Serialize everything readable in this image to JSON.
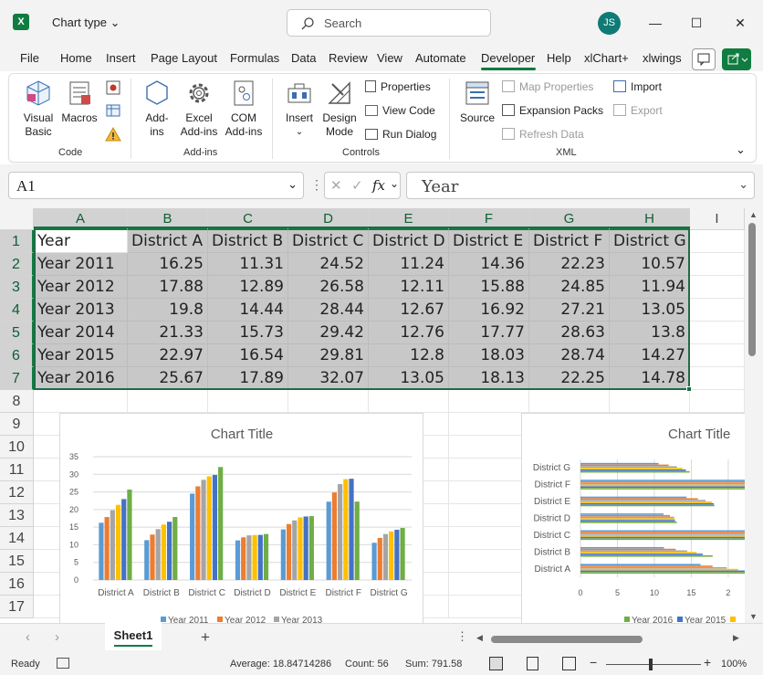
{
  "window": {
    "title": "Chart type",
    "user_initials": "JS"
  },
  "search": {
    "placeholder": "Search"
  },
  "tabs": [
    "File",
    "Home",
    "Insert",
    "Page Layout",
    "Formulas",
    "Data",
    "Review",
    "View",
    "Automate",
    "Developer",
    "Help",
    "xlChart+",
    "xlwings"
  ],
  "active_tab": "Developer",
  "ribbon": {
    "code": {
      "label": "Code",
      "visual_basic": [
        "Visual",
        "Basic"
      ],
      "macros": "Macros"
    },
    "addins": {
      "label": "Add-ins",
      "addins": [
        "Add-",
        "ins"
      ],
      "excel_addins": [
        "Excel",
        "Add-ins"
      ],
      "com_addins": [
        "COM",
        "Add-ins"
      ]
    },
    "controls": {
      "label": "Controls",
      "insert": "Insert",
      "design_mode": [
        "Design",
        "Mode"
      ],
      "properties": "Properties",
      "view_code": "View Code",
      "run_dialog": "Run Dialog"
    },
    "xml": {
      "label": "XML",
      "source": "Source",
      "map_properties": "Map Properties",
      "expansion_packs": "Expansion Packs",
      "refresh_data": "Refresh Data",
      "import": "Import",
      "export": "Export"
    }
  },
  "formula_bar": {
    "name_box": "A1",
    "formula": "Year"
  },
  "sheet": {
    "columns": [
      "A",
      "B",
      "C",
      "D",
      "E",
      "F",
      "G",
      "H",
      "I"
    ],
    "rows": [
      "1",
      "2",
      "3",
      "4",
      "5",
      "6",
      "7",
      "8",
      "9",
      "10",
      "11",
      "12",
      "13",
      "14",
      "15",
      "16",
      "17"
    ],
    "header_row": [
      "Year",
      "District A",
      "District B",
      "District C",
      "District D",
      "District E",
      "District F",
      "District G"
    ],
    "data": [
      [
        "Year 2011",
        "16.25",
        "11.31",
        "24.52",
        "11.24",
        "14.36",
        "22.23",
        "10.57"
      ],
      [
        "Year 2012",
        "17.88",
        "12.89",
        "26.58",
        "12.11",
        "15.88",
        "24.85",
        "11.94"
      ],
      [
        "Year 2013",
        "19.8",
        "14.44",
        "28.44",
        "12.67",
        "16.92",
        "27.21",
        "13.05"
      ],
      [
        "Year 2014",
        "21.33",
        "15.73",
        "29.42",
        "12.76",
        "17.77",
        "28.63",
        "13.8"
      ],
      [
        "Year 2015",
        "22.97",
        "16.54",
        "29.81",
        "12.8",
        "18.03",
        "28.74",
        "14.27"
      ],
      [
        "Year 2016",
        "25.67",
        "17.89",
        "32.07",
        "13.05",
        "18.13",
        "22.25",
        "14.78"
      ]
    ]
  },
  "chart_data": [
    {
      "type": "bar",
      "title": "Chart Title",
      "categories": [
        "District A",
        "District B",
        "District C",
        "District D",
        "District E",
        "District F",
        "District G"
      ],
      "ylim": [
        0,
        35
      ],
      "yticks": [
        "0",
        "5",
        "10",
        "15",
        "20",
        "25",
        "30",
        "35"
      ],
      "grid": true,
      "legend_position": "bottom",
      "legend_visible": [
        "Year 2011",
        "Year 2012",
        "Year 2013"
      ],
      "series": [
        {
          "name": "Year 2011",
          "values": [
            16.25,
            11.31,
            24.52,
            11.24,
            14.36,
            22.23,
            10.57
          ],
          "color": "#5b9bd5"
        },
        {
          "name": "Year 2012",
          "values": [
            17.88,
            12.89,
            26.58,
            12.11,
            15.88,
            24.85,
            11.94
          ],
          "color": "#ed7d31"
        },
        {
          "name": "Year 2013",
          "values": [
            19.8,
            14.44,
            28.44,
            12.67,
            16.92,
            27.21,
            13.05
          ],
          "color": "#a5a5a5"
        },
        {
          "name": "Year 2014",
          "values": [
            21.33,
            15.73,
            29.42,
            12.76,
            17.77,
            28.63,
            13.8
          ],
          "color": "#ffc000"
        },
        {
          "name": "Year 2015",
          "values": [
            22.97,
            16.54,
            29.81,
            12.8,
            18.03,
            28.74,
            14.27
          ],
          "color": "#4472c4"
        },
        {
          "name": "Year 2016",
          "values": [
            25.67,
            17.89,
            32.07,
            13.05,
            18.13,
            22.25,
            14.78
          ],
          "color": "#70ad47"
        }
      ]
    },
    {
      "type": "bar",
      "orientation": "horizontal",
      "title": "Chart Title",
      "categories": [
        "District A",
        "District B",
        "District C",
        "District D",
        "District E",
        "District F",
        "District G"
      ],
      "xlim": [
        0,
        20
      ],
      "xticks": [
        "0",
        "5",
        "10",
        "15",
        "2"
      ],
      "grid": true,
      "legend_position": "bottom",
      "legend_visible": [
        "Year 2016",
        "Year 2015"
      ],
      "series_ref": "same as first chart"
    }
  ],
  "sheet_tab": "Sheet1",
  "status": {
    "ready": "Ready",
    "average": "Average: 18.84714286",
    "count": "Count: 56",
    "sum": "Sum: 791.58",
    "zoom": "100%"
  },
  "colors": {
    "accent": "#107c41",
    "selection": "#c8c8c8"
  }
}
